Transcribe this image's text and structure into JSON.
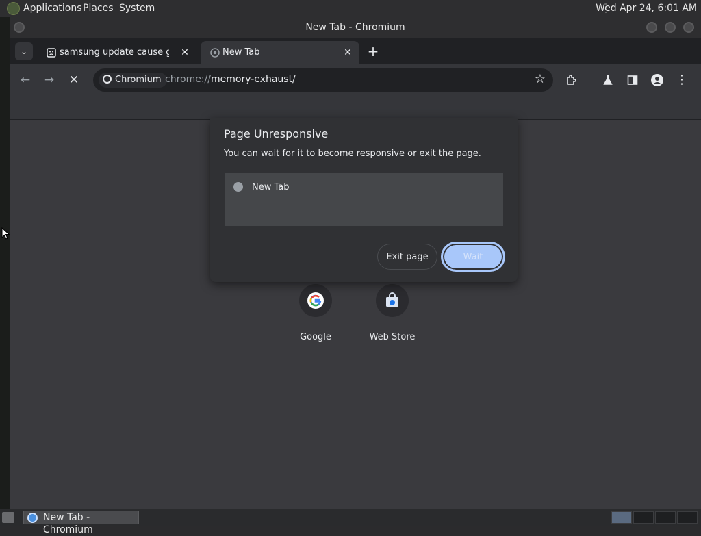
{
  "desktop_panel": {
    "menus": [
      "Applications",
      "Places",
      "System"
    ],
    "clock": "Wed Apr 24,  6:01 AM"
  },
  "window": {
    "title": "New Tab - Chromium"
  },
  "tabs": [
    {
      "title": "samsung update cause green",
      "active": false,
      "favicon": "sad-face-icon"
    },
    {
      "title": "New Tab",
      "active": true,
      "favicon": "chromium-icon"
    }
  ],
  "toolbar": {
    "site_chip_label": "Chromium",
    "url_scheme": "chrome://",
    "url_path": "memory-exhaust/"
  },
  "dialog": {
    "title": "Page Unresponsive",
    "description": "You can wait for it to become responsive or exit the page.",
    "pages": [
      "New Tab"
    ],
    "exit_label": "Exit page",
    "wait_label": "Wait"
  },
  "shortcuts": [
    {
      "label": "Google",
      "icon": "google-icon"
    },
    {
      "label": "Web Store",
      "icon": "web-store-icon"
    }
  ],
  "taskbar": {
    "task_label": "New Tab - Chromium"
  },
  "colors": {
    "accent": "#a8c7fa",
    "dialog_bg": "#303134",
    "page_bg": "#3a3a3e"
  }
}
